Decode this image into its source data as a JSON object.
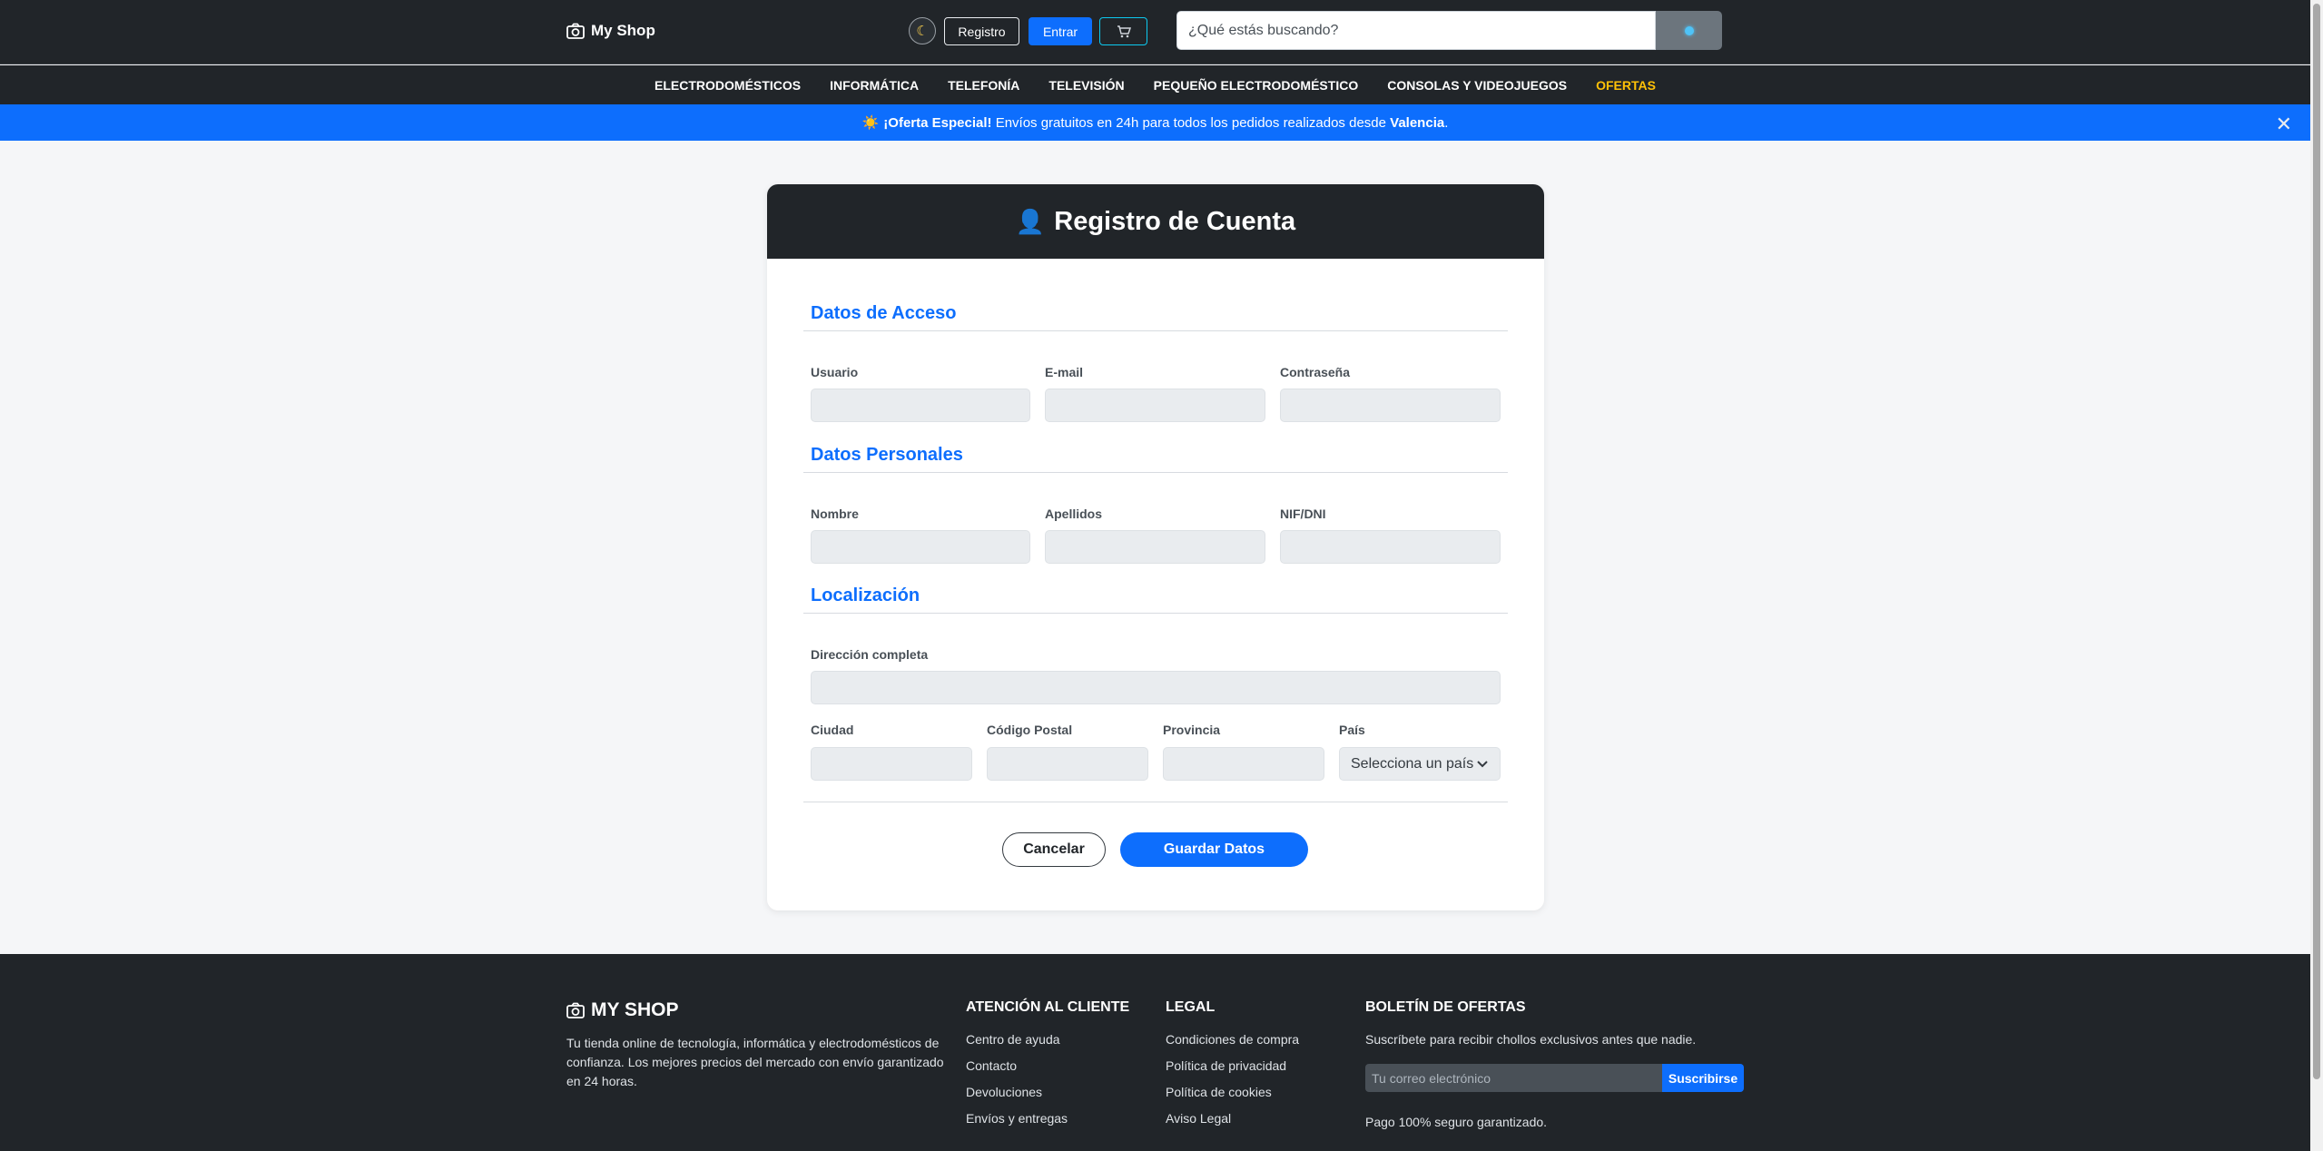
{
  "header": {
    "brand": "My Shop",
    "register_label": "Registro",
    "login_label": "Entrar",
    "theme_icon": "moon-icon",
    "cart_icon": "cart-icon",
    "search_placeholder": "¿Qué estás buscando?"
  },
  "nav": {
    "items": [
      "ELECTRODOMÉSTICOS",
      "INFORMÁTICA",
      "TELEFONÍA",
      "TELEVISIÓN",
      "PEQUEÑO ELECTRODOMÉSTICO",
      "CONSOLAS Y VIDEOJUEGOS",
      "OFERTAS"
    ],
    "offers_color": "#ffc107"
  },
  "promo": {
    "icon": "☀️",
    "strong": "¡Oferta Especial!",
    "text": "Envíos gratuitos en 24h para todos los pedidos realizados desde",
    "city": "Valencia",
    "end": "."
  },
  "form": {
    "title": "Registro de Cuenta",
    "title_icon": "👤",
    "sections": {
      "access": "Datos de Acceso",
      "personal": "Datos Personales",
      "location": "Localización"
    },
    "labels": {
      "user": "Usuario",
      "email": "E-mail",
      "password": "Contraseña",
      "name": "Nombre",
      "surname": "Apellidos",
      "nif": "NIF/DNI",
      "address": "Dirección completa",
      "city": "Ciudad",
      "zip": "Código Postal",
      "province": "Provincia",
      "country": "País"
    },
    "country_selected": "Selecciona un país",
    "cancel_label": "Cancelar",
    "save_label": "Guardar Datos"
  },
  "footer": {
    "brand": "MY SHOP",
    "description": "Tu tienda online de tecnología, informática y electrodomésticos de confianza. Los mejores precios del mercado con envío garantizado en 24 horas.",
    "customer_title": "ATENCIÓN AL CLIENTE",
    "customer_links": [
      "Centro de ayuda",
      "Contacto",
      "Devoluciones",
      "Envíos y entregas"
    ],
    "legal_title": "LEGAL",
    "legal_links": [
      "Condiciones de compra",
      "Política de privacidad",
      "Política de cookies",
      "Aviso Legal"
    ],
    "newsletter_title": "BOLETÍN DE OFERTAS",
    "newsletter_text": "Suscríbete para recibir chollos exclusivos antes que nadie.",
    "email_placeholder": "Tu correo electrónico",
    "subscribe_label": "Suscribirse",
    "secure_text": "Pago 100% seguro garantizado."
  },
  "colors": {
    "primary": "#0d6efd",
    "dark": "#212529",
    "accent": "#ffc107"
  }
}
